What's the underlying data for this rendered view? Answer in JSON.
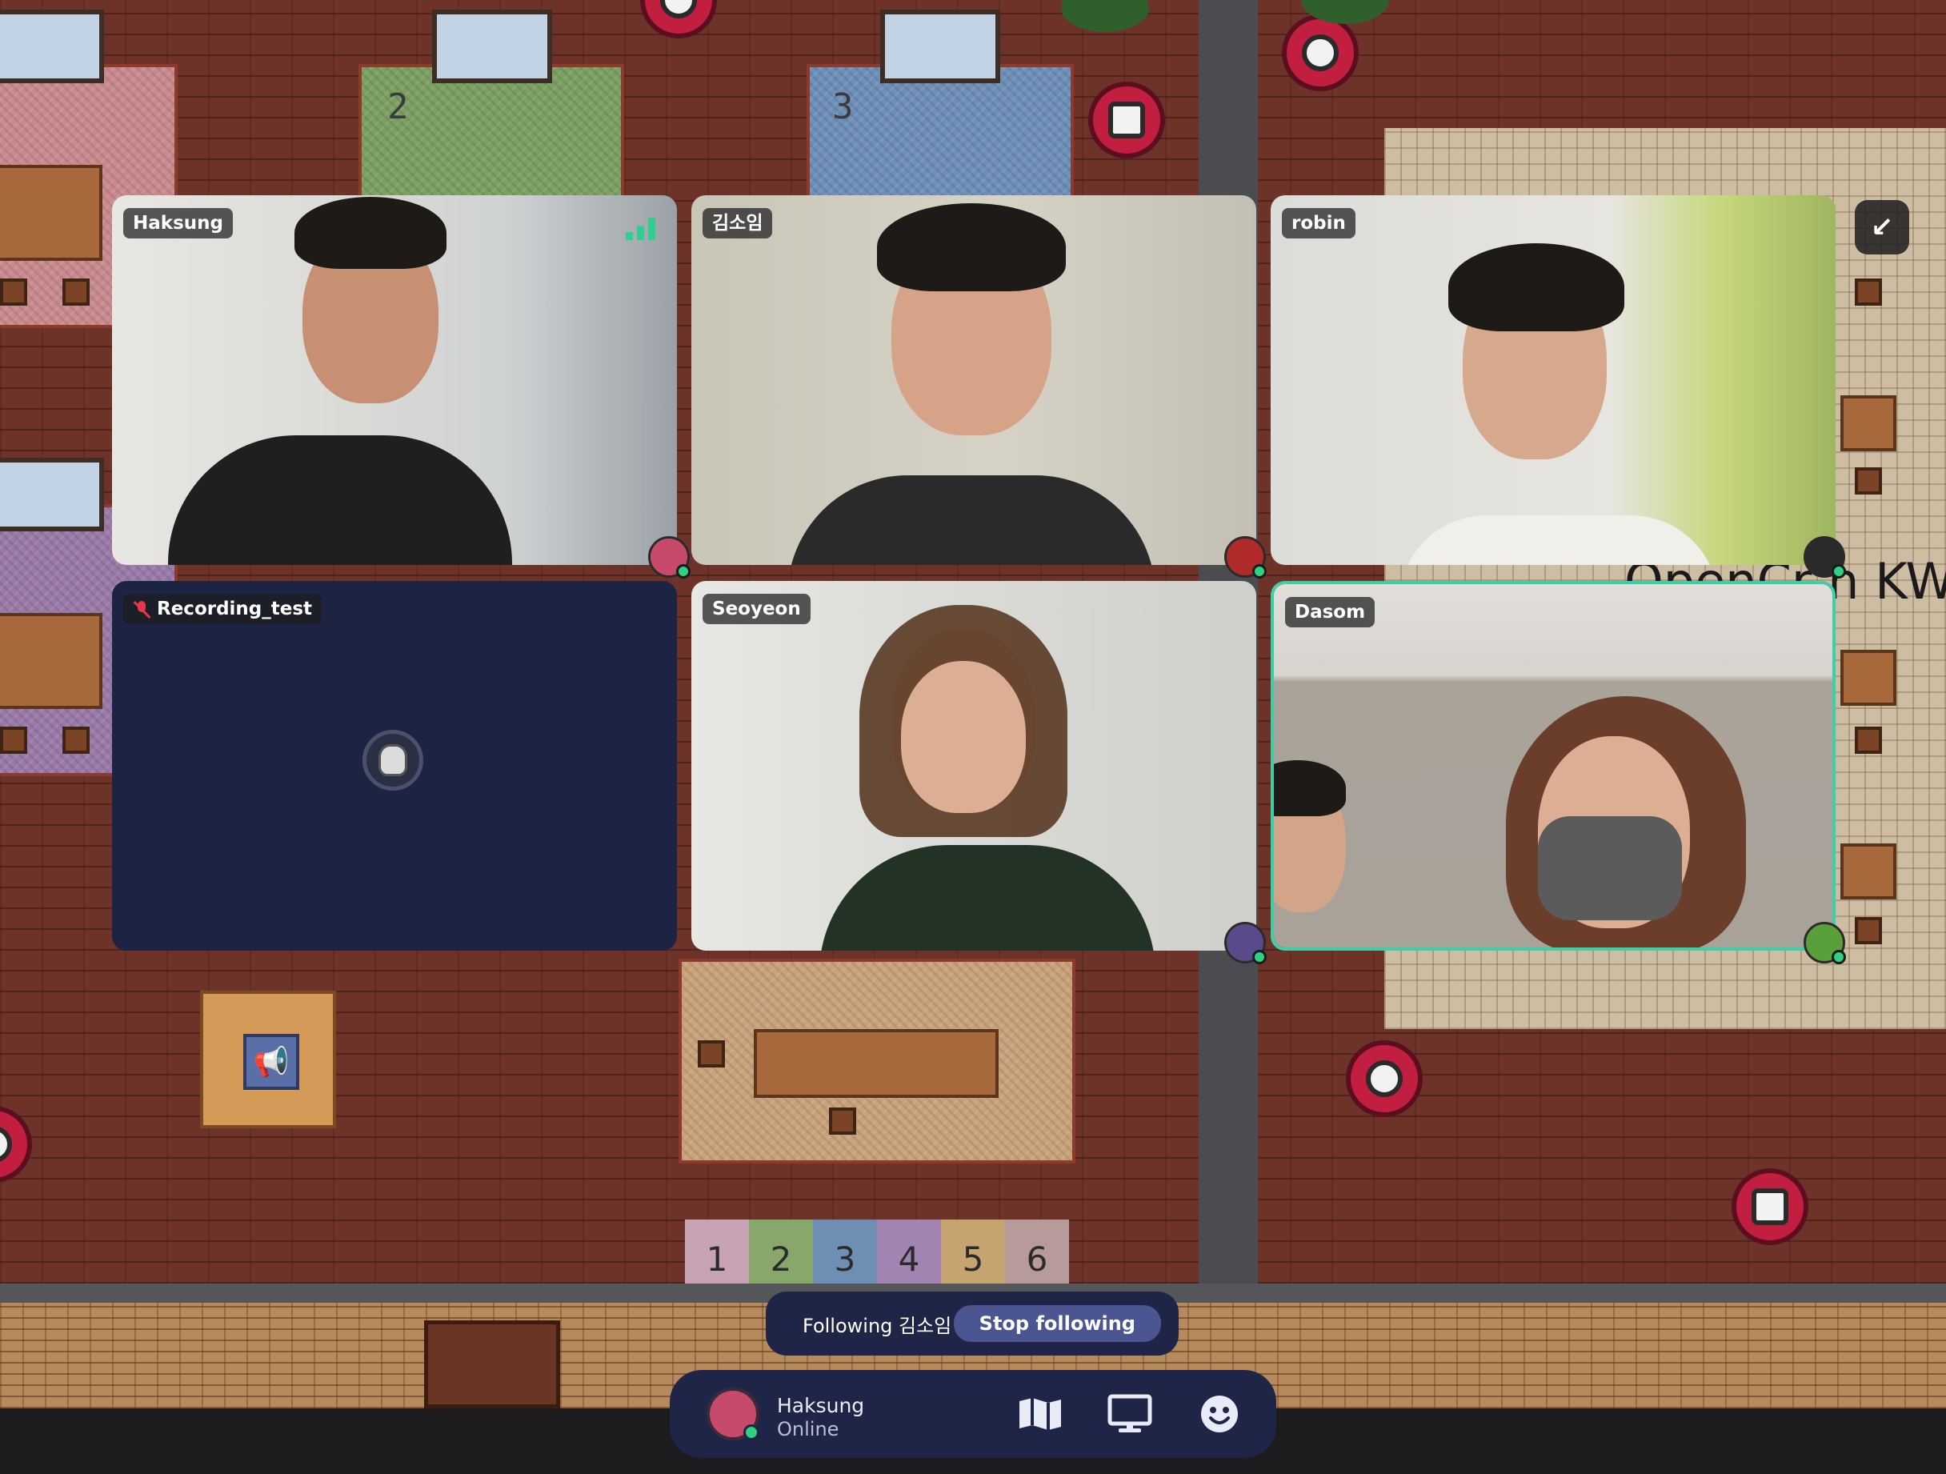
{
  "map": {
    "room_numbers": [
      "2",
      "3"
    ],
    "color_strip": [
      "1",
      "2",
      "3",
      "4",
      "5",
      "6"
    ],
    "sign_text": "OpenCr  n KW"
  },
  "tiles": [
    {
      "name": "Haksung",
      "show_signal": true,
      "active": false
    },
    {
      "name": "김소임",
      "active": false
    },
    {
      "name": "robin",
      "active": false
    },
    {
      "name": "Recording_test",
      "muted": true,
      "video_off": true,
      "active": false
    },
    {
      "name": "Seoyeon",
      "active": false
    },
    {
      "name": "Dasom",
      "active": true
    }
  ],
  "follow": {
    "text": "Following 김소임",
    "stop_label": "Stop following"
  },
  "dock": {
    "user_name": "Haksung",
    "status": "Online",
    "icons": [
      "map-icon",
      "screen-share-icon",
      "emoji-icon"
    ]
  },
  "colors": {
    "active_border": "#3ecfa8",
    "dock_bg": "#1f2546",
    "online_dot": "#2fd07f",
    "stop_button": "#4a5591",
    "muted_icon": "#e8364b"
  }
}
